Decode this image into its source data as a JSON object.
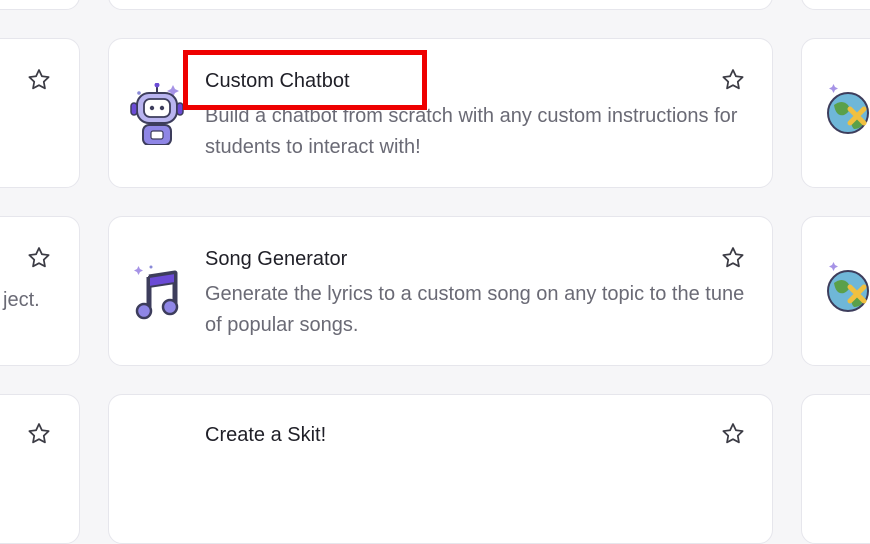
{
  "cards": [
    {
      "title": "Custom Chatbot",
      "description": "Build a chatbot from scratch with any custom instructions for students to interact with!",
      "icon": "robot-icon"
    },
    {
      "title": "Song Generator",
      "description": "Generate the lyrics to a custom song on any topic to the tune of popular songs.",
      "icon": "music-note-icon"
    },
    {
      "title": "Create a Skit!",
      "description": "",
      "icon": ""
    }
  ],
  "left_column": {
    "partial_text_row2": "ject."
  },
  "right_column": {
    "icon": "globe-icon"
  },
  "colors": {
    "highlight": "#ee0000",
    "icon_accent": "#6b4bd6"
  }
}
